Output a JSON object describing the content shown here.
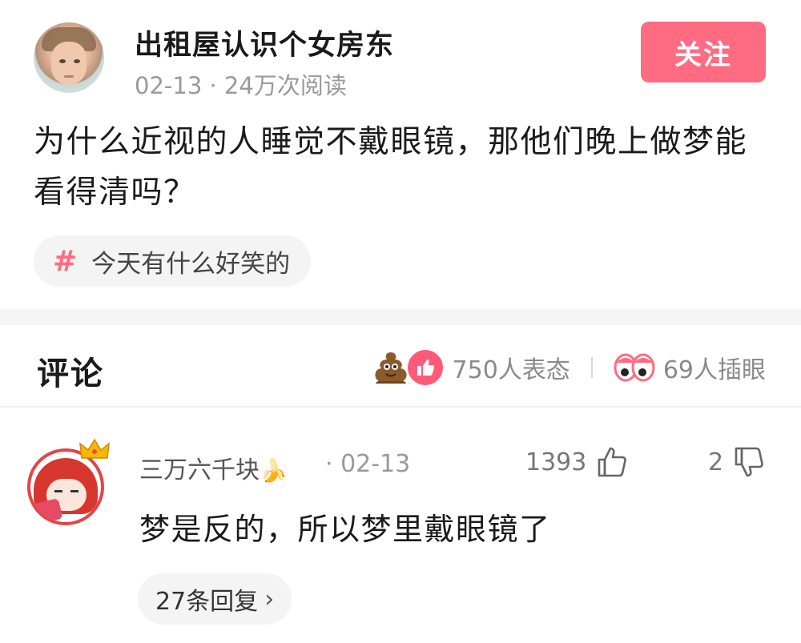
{
  "post": {
    "author_name": "出租屋认识个女房东",
    "meta": "02-13 · 24万次阅读",
    "follow_label": "关注",
    "title": "为什么近视的人睡觉不戴眼镜，那他们晚上做梦能看得清吗？",
    "topic_tag": "今天有什么好笑的",
    "topic_icon": "#"
  },
  "comments_section": {
    "title": "评论",
    "reaction_count": "750人表态",
    "eye_count": "69人插眼"
  },
  "comments": [
    {
      "username": "三万六千块",
      "username_emoji": "🍌",
      "date": "· 02-13",
      "likes": "1393",
      "dislikes": "2",
      "text": "梦是反的，所以梦里戴眼镜了",
      "replies_label": "27条回复",
      "replies_chevron": "›"
    }
  ],
  "colors": {
    "accent": "#ff6b81",
    "like_red": "#ff5b79",
    "text_primary": "#1b1b1b",
    "text_secondary": "#9a9a9a",
    "chip_bg": "#f4f4f4"
  }
}
